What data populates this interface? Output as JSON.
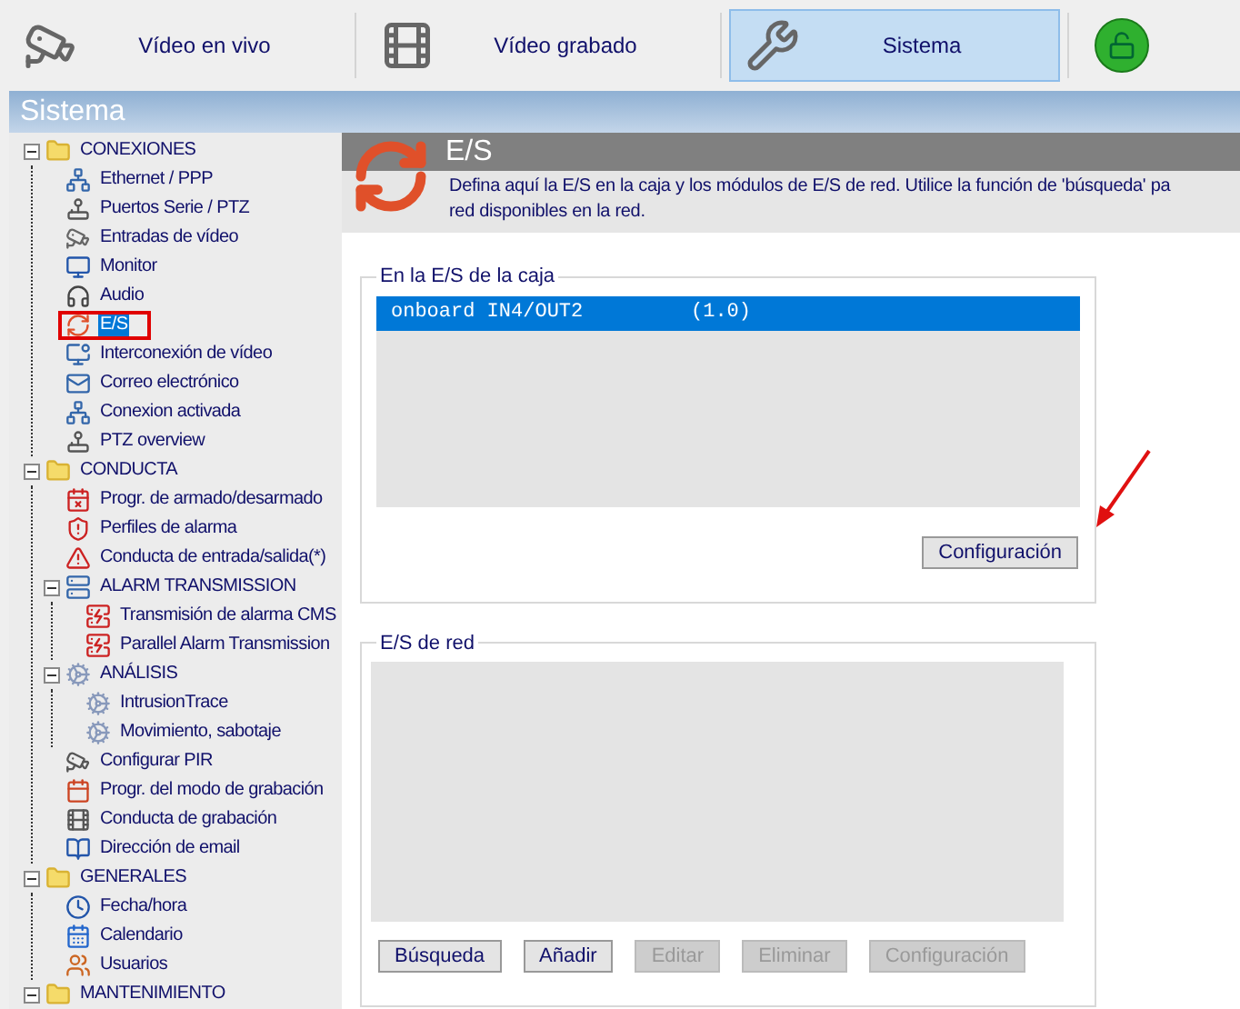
{
  "nav": {
    "tabs": [
      {
        "label": "Vídeo en vivo",
        "selected": false
      },
      {
        "label": "Vídeo grabado",
        "selected": false
      },
      {
        "label": "Sistema",
        "selected": true
      }
    ],
    "lock": {
      "locked": false
    }
  },
  "section_title": "Sistema",
  "sidebar": {
    "items": [
      {
        "label": "CONEXIONES",
        "expanded": true,
        "children": [
          {
            "label": "Ethernet / PPP",
            "selected": false
          },
          {
            "label": "Puertos Serie / PTZ",
            "selected": false
          },
          {
            "label": "Entradas de vídeo",
            "selected": false
          },
          {
            "label": "Monitor",
            "selected": false
          },
          {
            "label": "Audio",
            "selected": false
          },
          {
            "label": "E/S",
            "selected": true,
            "annotated": true
          },
          {
            "label": "Interconexión de vídeo",
            "selected": false
          },
          {
            "label": "Correo electrónico",
            "selected": false
          },
          {
            "label": "Conexion activada",
            "selected": false
          },
          {
            "label": "PTZ overview",
            "selected": false
          }
        ]
      },
      {
        "label": "CONDUCTA",
        "expanded": true,
        "children": [
          {
            "label": "Progr. de armado/desarmado",
            "selected": false
          },
          {
            "label": "Perfiles de alarma",
            "selected": false
          },
          {
            "label": "Conducta de entrada/salida(*)",
            "selected": false
          },
          {
            "label": "ALARM TRANSMISSION",
            "expanded": true,
            "children": [
              {
                "label": "Transmisión de alarma CMS",
                "selected": false
              },
              {
                "label": "Parallel Alarm Transmission",
                "selected": false
              }
            ]
          },
          {
            "label": "ANÁLISIS",
            "expanded": true,
            "children": [
              {
                "label": "IntrusionTrace",
                "selected": false
              },
              {
                "label": "Movimiento, sabotaje",
                "selected": false
              }
            ]
          },
          {
            "label": "Configurar PIR",
            "selected": false
          },
          {
            "label": "Progr. del modo de grabación",
            "selected": false
          },
          {
            "label": "Conducta de grabación",
            "selected": false
          },
          {
            "label": "Dirección de email",
            "selected": false
          }
        ]
      },
      {
        "label": "GENERALES",
        "expanded": true,
        "children": [
          {
            "label": "Fecha/hora",
            "selected": false
          },
          {
            "label": "Calendario",
            "selected": false
          },
          {
            "label": "Usuarios",
            "selected": false
          }
        ]
      },
      {
        "label": "MANTENIMIENTO",
        "expanded": true
      }
    ]
  },
  "page": {
    "title": "E/S",
    "description_lines": [
      "Defina aquí la E/S en la caja y los módulos de E/S de red. Utilice la función de 'búsqueda' pa",
      "red disponibles en la red."
    ],
    "local_io": {
      "legend": "En la E/S de la caja",
      "rows": [
        {
          "name": "onboard IN4/OUT2",
          "version": "(1.0)",
          "selected": true
        }
      ],
      "buttons": [
        {
          "label": "Configuración",
          "disabled": false,
          "annotated": true
        }
      ]
    },
    "network_io": {
      "legend": "E/S de red",
      "buttons": [
        {
          "label": "Búsqueda",
          "disabled": false
        },
        {
          "label": "Añadir",
          "disabled": false
        },
        {
          "label": "Editar",
          "disabled": true
        },
        {
          "label": "Eliminar",
          "disabled": true
        },
        {
          "label": "Configuración",
          "disabled": true
        }
      ]
    }
  }
}
